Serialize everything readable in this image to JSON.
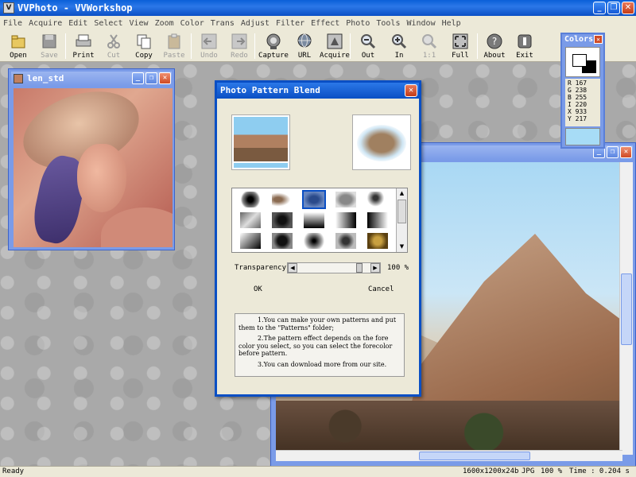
{
  "window": {
    "app": "VVPhoto",
    "sep": " - ",
    "doc": "VVWorkshop",
    "app_icon_letter": "V"
  },
  "menu": [
    "File",
    "Acquire",
    "Edit",
    "Select",
    "View",
    "Zoom",
    "Color",
    "Trans",
    "Adjust",
    "Filter",
    "Effect",
    "Photo",
    "Tools",
    "Window",
    "Help"
  ],
  "toolbar": [
    {
      "label": "Open",
      "icon": "open-icon",
      "disabled": false
    },
    {
      "label": "Save",
      "icon": "save-icon",
      "disabled": true
    },
    {
      "label": "Print",
      "icon": "print-icon",
      "disabled": false
    },
    {
      "label": "Cut",
      "icon": "cut-icon",
      "disabled": true
    },
    {
      "label": "Copy",
      "icon": "copy-icon",
      "disabled": false
    },
    {
      "label": "Paste",
      "icon": "paste-icon",
      "disabled": true
    },
    {
      "label": "Undo",
      "icon": "undo-icon",
      "disabled": true
    },
    {
      "label": "Redo",
      "icon": "redo-icon",
      "disabled": true
    },
    {
      "label": "Capture",
      "icon": "capture-icon",
      "disabled": false
    },
    {
      "label": "URL",
      "icon": "globe-icon",
      "disabled": false
    },
    {
      "label": "Acquire",
      "icon": "acquire-icon",
      "disabled": false
    },
    {
      "label": "Out",
      "icon": "zoom-out-icon",
      "disabled": false
    },
    {
      "label": "In",
      "icon": "zoom-in-icon",
      "disabled": false
    },
    {
      "label": "1:1",
      "icon": "zoom-actual-icon",
      "disabled": true
    },
    {
      "label": "Full",
      "icon": "fullscreen-icon",
      "disabled": false
    },
    {
      "label": "About",
      "icon": "about-icon",
      "disabled": false
    },
    {
      "label": "Exit",
      "icon": "exit-icon",
      "disabled": false
    }
  ],
  "child_window": {
    "title": "len_std"
  },
  "colors_panel": {
    "title": "Colors",
    "readout": [
      "R 167",
      "G 238",
      "B 255",
      "I 220",
      "X 933",
      "Y 217"
    ],
    "preview_color": "#a7dcf6"
  },
  "dialog": {
    "title": "Photo Pattern Blend",
    "transparency_label": "Transparency",
    "transparency_value": "100 %",
    "transparency_level": 0.88,
    "ok": "OK",
    "cancel": "Cancel",
    "notes": [
      "1.You can make your own patterns and put them to the \"Patterns\" folder;",
      "2.The pattern effect depends on the fore color you select, so you can select the forecolor before pattern.",
      "3.You can download more from our site."
    ]
  },
  "status": {
    "ready": "Ready",
    "dims": "1600x1200x24b",
    "format": "JPG",
    "zoom": "100 %",
    "time": "Time : 0.204 s"
  },
  "colors": {
    "titlebar": "#0a4fc4",
    "child_title": "#7a9be8"
  }
}
